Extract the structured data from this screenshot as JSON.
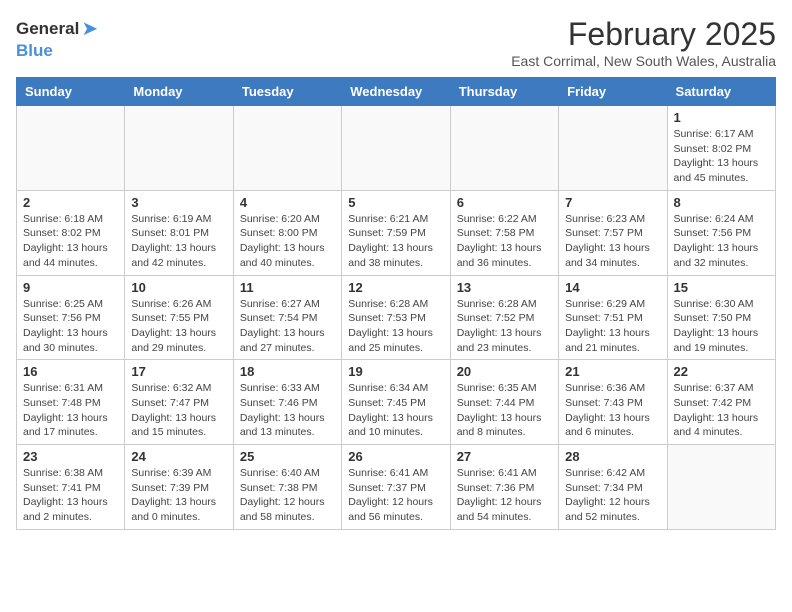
{
  "header": {
    "logo_general": "General",
    "logo_blue": "Blue",
    "title": "February 2025",
    "subtitle": "East Corrimal, New South Wales, Australia"
  },
  "weekdays": [
    "Sunday",
    "Monday",
    "Tuesday",
    "Wednesday",
    "Thursday",
    "Friday",
    "Saturday"
  ],
  "weeks": [
    [
      {
        "day": "",
        "info": ""
      },
      {
        "day": "",
        "info": ""
      },
      {
        "day": "",
        "info": ""
      },
      {
        "day": "",
        "info": ""
      },
      {
        "day": "",
        "info": ""
      },
      {
        "day": "",
        "info": ""
      },
      {
        "day": "1",
        "info": "Sunrise: 6:17 AM\nSunset: 8:02 PM\nDaylight: 13 hours\nand 45 minutes."
      }
    ],
    [
      {
        "day": "2",
        "info": "Sunrise: 6:18 AM\nSunset: 8:02 PM\nDaylight: 13 hours\nand 44 minutes."
      },
      {
        "day": "3",
        "info": "Sunrise: 6:19 AM\nSunset: 8:01 PM\nDaylight: 13 hours\nand 42 minutes."
      },
      {
        "day": "4",
        "info": "Sunrise: 6:20 AM\nSunset: 8:00 PM\nDaylight: 13 hours\nand 40 minutes."
      },
      {
        "day": "5",
        "info": "Sunrise: 6:21 AM\nSunset: 7:59 PM\nDaylight: 13 hours\nand 38 minutes."
      },
      {
        "day": "6",
        "info": "Sunrise: 6:22 AM\nSunset: 7:58 PM\nDaylight: 13 hours\nand 36 minutes."
      },
      {
        "day": "7",
        "info": "Sunrise: 6:23 AM\nSunset: 7:57 PM\nDaylight: 13 hours\nand 34 minutes."
      },
      {
        "day": "8",
        "info": "Sunrise: 6:24 AM\nSunset: 7:56 PM\nDaylight: 13 hours\nand 32 minutes."
      }
    ],
    [
      {
        "day": "9",
        "info": "Sunrise: 6:25 AM\nSunset: 7:56 PM\nDaylight: 13 hours\nand 30 minutes."
      },
      {
        "day": "10",
        "info": "Sunrise: 6:26 AM\nSunset: 7:55 PM\nDaylight: 13 hours\nand 29 minutes."
      },
      {
        "day": "11",
        "info": "Sunrise: 6:27 AM\nSunset: 7:54 PM\nDaylight: 13 hours\nand 27 minutes."
      },
      {
        "day": "12",
        "info": "Sunrise: 6:28 AM\nSunset: 7:53 PM\nDaylight: 13 hours\nand 25 minutes."
      },
      {
        "day": "13",
        "info": "Sunrise: 6:28 AM\nSunset: 7:52 PM\nDaylight: 13 hours\nand 23 minutes."
      },
      {
        "day": "14",
        "info": "Sunrise: 6:29 AM\nSunset: 7:51 PM\nDaylight: 13 hours\nand 21 minutes."
      },
      {
        "day": "15",
        "info": "Sunrise: 6:30 AM\nSunset: 7:50 PM\nDaylight: 13 hours\nand 19 minutes."
      }
    ],
    [
      {
        "day": "16",
        "info": "Sunrise: 6:31 AM\nSunset: 7:48 PM\nDaylight: 13 hours\nand 17 minutes."
      },
      {
        "day": "17",
        "info": "Sunrise: 6:32 AM\nSunset: 7:47 PM\nDaylight: 13 hours\nand 15 minutes."
      },
      {
        "day": "18",
        "info": "Sunrise: 6:33 AM\nSunset: 7:46 PM\nDaylight: 13 hours\nand 13 minutes."
      },
      {
        "day": "19",
        "info": "Sunrise: 6:34 AM\nSunset: 7:45 PM\nDaylight: 13 hours\nand 10 minutes."
      },
      {
        "day": "20",
        "info": "Sunrise: 6:35 AM\nSunset: 7:44 PM\nDaylight: 13 hours\nand 8 minutes."
      },
      {
        "day": "21",
        "info": "Sunrise: 6:36 AM\nSunset: 7:43 PM\nDaylight: 13 hours\nand 6 minutes."
      },
      {
        "day": "22",
        "info": "Sunrise: 6:37 AM\nSunset: 7:42 PM\nDaylight: 13 hours\nand 4 minutes."
      }
    ],
    [
      {
        "day": "23",
        "info": "Sunrise: 6:38 AM\nSunset: 7:41 PM\nDaylight: 13 hours\nand 2 minutes."
      },
      {
        "day": "24",
        "info": "Sunrise: 6:39 AM\nSunset: 7:39 PM\nDaylight: 13 hours\nand 0 minutes."
      },
      {
        "day": "25",
        "info": "Sunrise: 6:40 AM\nSunset: 7:38 PM\nDaylight: 12 hours\nand 58 minutes."
      },
      {
        "day": "26",
        "info": "Sunrise: 6:41 AM\nSunset: 7:37 PM\nDaylight: 12 hours\nand 56 minutes."
      },
      {
        "day": "27",
        "info": "Sunrise: 6:41 AM\nSunset: 7:36 PM\nDaylight: 12 hours\nand 54 minutes."
      },
      {
        "day": "28",
        "info": "Sunrise: 6:42 AM\nSunset: 7:34 PM\nDaylight: 12 hours\nand 52 minutes."
      },
      {
        "day": "",
        "info": ""
      }
    ]
  ]
}
